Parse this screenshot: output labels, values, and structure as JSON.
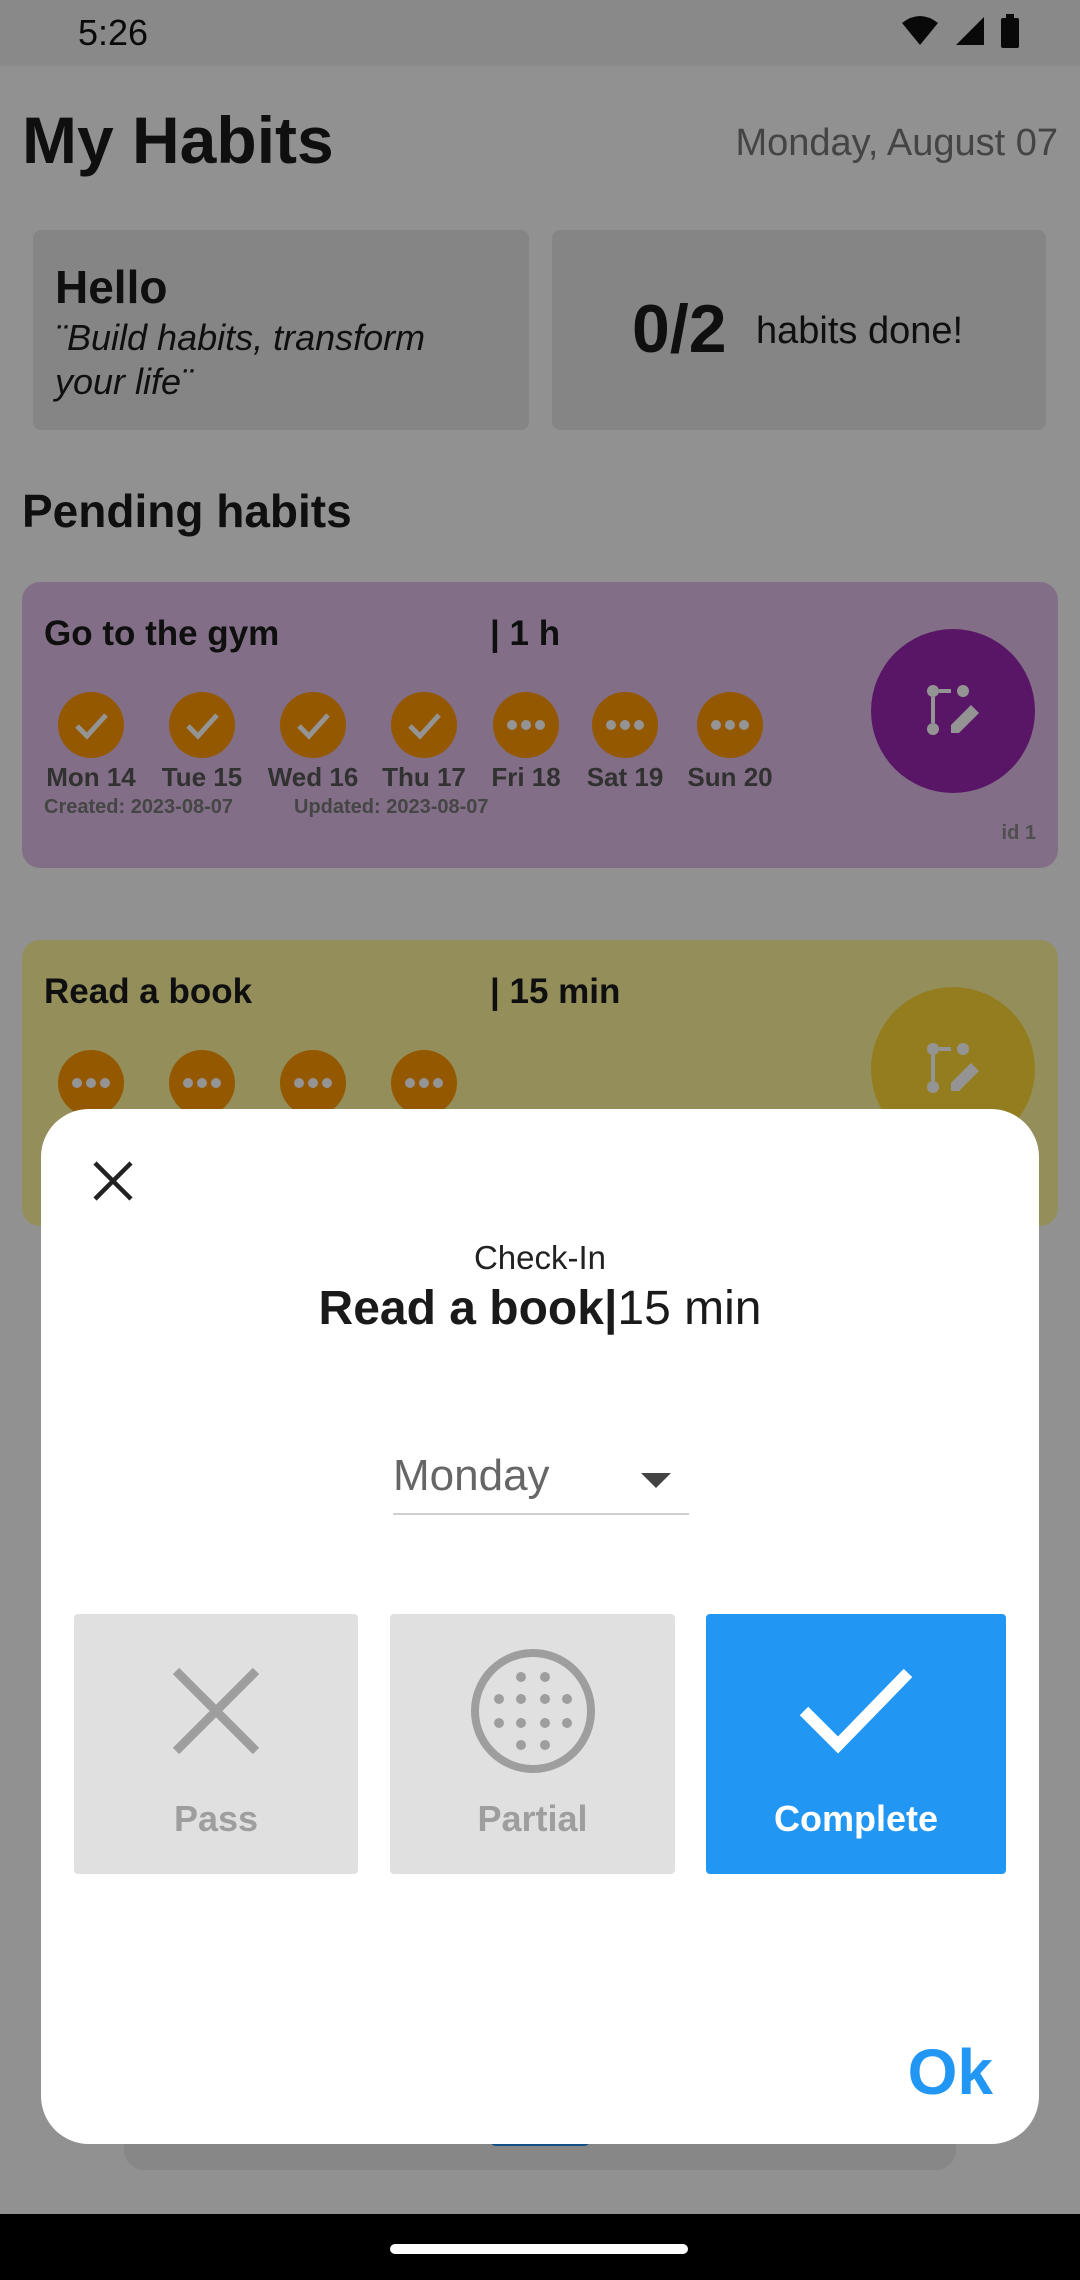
{
  "status_bar": {
    "time": "5:26"
  },
  "header": {
    "title": "My Habits",
    "date": "Monday, August 07"
  },
  "greeting": {
    "title": "Hello",
    "quote": "¨Build habits, transform your life¨"
  },
  "progress": {
    "count": "0/2",
    "label": "habits done!"
  },
  "section_title": "Pending habits",
  "habits": [
    {
      "name": "Go to the gym",
      "duration": "| 1 h",
      "color": "#9c27b0",
      "card_color": "#e1bee7",
      "days": [
        {
          "label": "Mon 14",
          "status": "done"
        },
        {
          "label": "Tue 15",
          "status": "done"
        },
        {
          "label": "Wed 16",
          "status": "done"
        },
        {
          "label": "Thu 17",
          "status": "done"
        },
        {
          "label": "Fri 18",
          "status": "pending"
        },
        {
          "label": "Sat 19",
          "status": "pending"
        },
        {
          "label": "Sun 20",
          "status": "pending"
        }
      ],
      "created": "Created: 2023-08-07",
      "updated": "Updated: 2023-08-07",
      "id_label": "id 1"
    },
    {
      "name": "Read a book",
      "duration": "| 15 min",
      "color": "#fdd835",
      "card_color": "#fff59d",
      "days": [
        {
          "status": "pending"
        },
        {
          "status": "pending"
        },
        {
          "status": "pending"
        },
        {
          "status": "pending"
        }
      ]
    }
  ],
  "dialog": {
    "subtitle": "Check-In",
    "habit_name": "Read a book",
    "separator": "|",
    "duration": "15 min",
    "day_select": {
      "selected": "Monday"
    },
    "options": [
      {
        "label": "Pass",
        "icon": "close-icon",
        "selected": false
      },
      {
        "label": "Partial",
        "icon": "partial-dots-icon",
        "selected": false
      },
      {
        "label": "Complete",
        "icon": "check-icon",
        "selected": true
      }
    ],
    "ok_label": "Ok"
  },
  "colors": {
    "accent": "#2196f3",
    "day_circle": "#ff9800"
  }
}
